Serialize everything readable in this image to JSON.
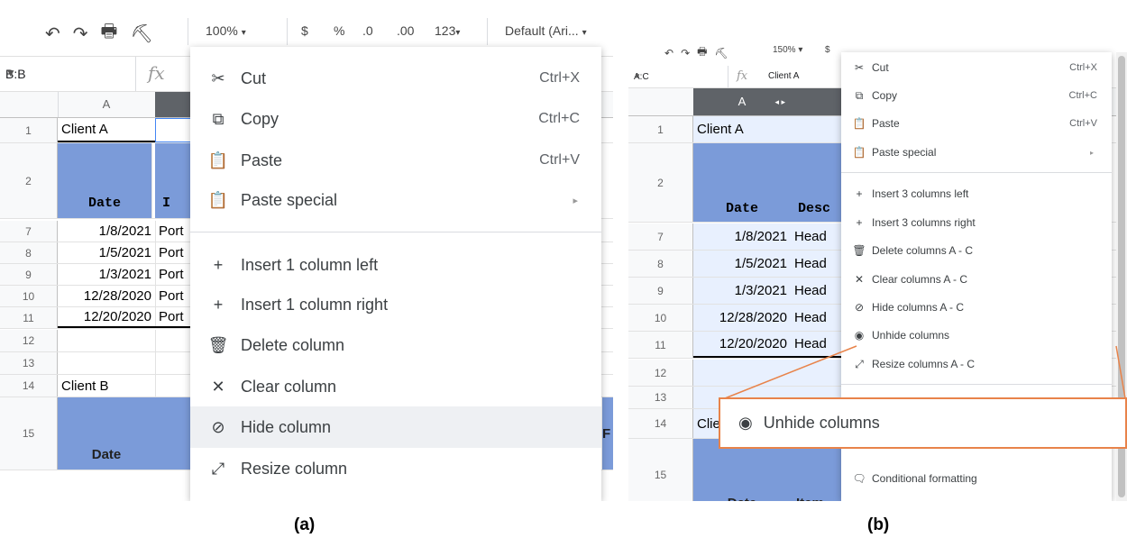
{
  "panel_a": {
    "toolbar": {
      "icons": [
        "undo-icon",
        "redo-icon",
        "print-icon",
        "paint-format-icon"
      ],
      "zoom": "100%",
      "zoom_caret": "▾",
      "currency": "$",
      "percent": "%",
      "decrease_decimal": ".0",
      "increase_decimal": ".00",
      "more_formats": "123",
      "more_formats_caret": "▾",
      "font": "Default (Ari...",
      "font_caret": "▾"
    },
    "name_box": "B:B",
    "fx": "fx",
    "col_headers": [
      "A"
    ],
    "rows": [
      {
        "num": "1",
        "a": "Client A"
      },
      {
        "num": "2",
        "a": "Date",
        "b": "I"
      },
      {
        "num": "7",
        "a": "1/8/2021",
        "b": "Port"
      },
      {
        "num": "8",
        "a": "1/5/2021",
        "b": "Port"
      },
      {
        "num": "9",
        "a": "1/3/2021",
        "b": "Port"
      },
      {
        "num": "10",
        "a": "12/28/2020",
        "b": "Port"
      },
      {
        "num": "11",
        "a": "12/20/2020",
        "b": "Port"
      },
      {
        "num": "12",
        "a": ""
      },
      {
        "num": "13",
        "a": ""
      },
      {
        "num": "14",
        "a": "Client B"
      },
      {
        "num": "15",
        "a": "Date",
        "b": "",
        "c": "F"
      }
    ],
    "menu": [
      {
        "icon": "✂",
        "label": "Cut",
        "shortcut": "Ctrl+X"
      },
      {
        "icon": "⧉",
        "label": "Copy",
        "shortcut": "Ctrl+C"
      },
      {
        "icon": "📋",
        "label": "Paste",
        "shortcut": "Ctrl+V"
      },
      {
        "icon": "📋",
        "label": "Paste special",
        "arrow": "▸"
      },
      {
        "icon": "+",
        "label": "Insert 1 column left"
      },
      {
        "icon": "+",
        "label": "Insert 1 column right"
      },
      {
        "icon": "🗑",
        "label": "Delete column"
      },
      {
        "icon": "✕",
        "label": "Clear column"
      },
      {
        "icon": "⊘",
        "label": "Hide column"
      },
      {
        "icon": "⤢",
        "label": "Resize column"
      }
    ],
    "caption": "(a)"
  },
  "panel_b": {
    "toolbar": {
      "zoom": "150%",
      "zoom_caret": "▾",
      "currency": "$"
    },
    "name_box": "A:C",
    "fx": "fx",
    "formula_value": "Client A",
    "col_headers": [
      "A"
    ],
    "col_arrows": "◂ ▸",
    "rows": [
      {
        "num": "1",
        "a": "Client A"
      },
      {
        "num": "2",
        "a": "Date",
        "b": "Desc"
      },
      {
        "num": "7",
        "a": "1/8/2021",
        "b": "Head"
      },
      {
        "num": "8",
        "a": "1/5/2021",
        "b": "Head"
      },
      {
        "num": "9",
        "a": "1/3/2021",
        "b": "Head"
      },
      {
        "num": "10",
        "a": "12/28/2020",
        "b": "Head"
      },
      {
        "num": "11",
        "a": "12/20/2020",
        "b": "Head"
      },
      {
        "num": "12",
        "a": ""
      },
      {
        "num": "13",
        "a": ""
      },
      {
        "num": "14",
        "a": "Clie"
      },
      {
        "num": "15",
        "a": "Date",
        "b": "Item"
      }
    ],
    "menu": [
      {
        "icon": "✂",
        "label": "Cut",
        "shortcut": "Ctrl+X"
      },
      {
        "icon": "⧉",
        "label": "Copy",
        "shortcut": "Ctrl+C"
      },
      {
        "icon": "📋",
        "label": "Paste",
        "shortcut": "Ctrl+V"
      },
      {
        "icon": "📋",
        "label": "Paste special",
        "arrow": "▸"
      },
      {
        "icon": "+",
        "label": "Insert 3 columns left"
      },
      {
        "icon": "+",
        "label": "Insert 3 columns right"
      },
      {
        "icon": "🗑",
        "label": "Delete columns A - C"
      },
      {
        "icon": "✕",
        "label": "Clear columns A - C"
      },
      {
        "icon": "⊘",
        "label": "Hide columns A - C"
      },
      {
        "icon": "◉",
        "label": "Unhide columns"
      },
      {
        "icon": "⤢",
        "label": "Resize columns A - C"
      },
      {
        "icon": "🗨",
        "label": "Conditional formatting"
      }
    ],
    "callout": {
      "icon": "◉",
      "label": "Unhide columns"
    },
    "caption": "(b)"
  },
  "colors": {
    "header_fill": "#7b9bd9",
    "selected_col": "#5f6368",
    "callout_border": "#e8834a",
    "date_text": "#7a3c00"
  }
}
